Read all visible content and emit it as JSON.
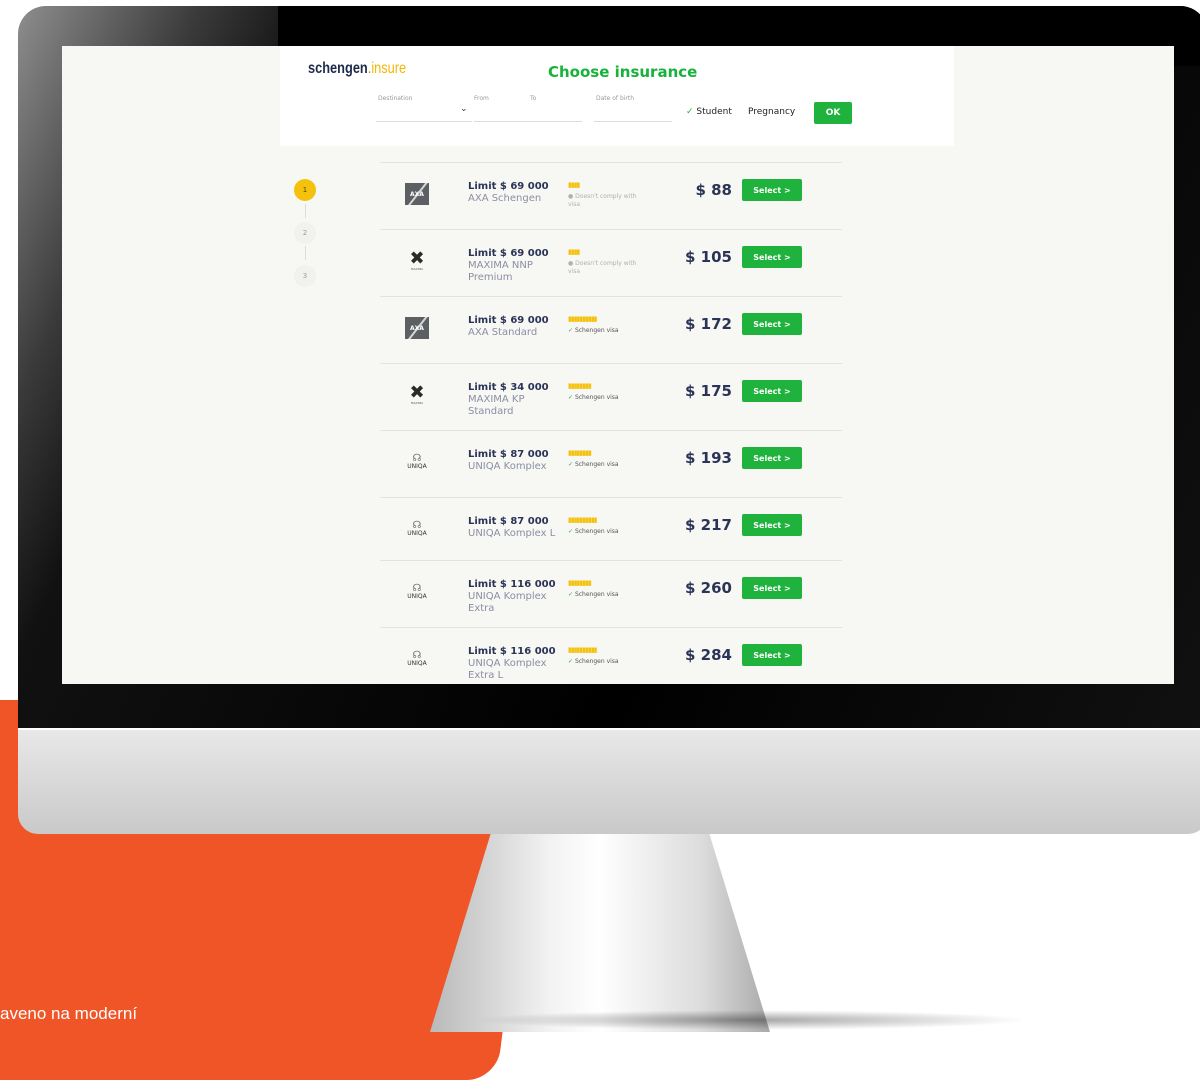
{
  "caption": "aveno na moderní",
  "app": {
    "logo": {
      "part1": "schengen",
      "part2": ".",
      "part3": "insure"
    },
    "title": "Choose insurance",
    "filters": {
      "destination_label": "Destination",
      "from_label": "From",
      "to_label": "To",
      "dob_label": "Date of birth",
      "student_label": "Student",
      "student_checked": true,
      "pregnancy_label": "Pregnancy",
      "pregnancy_checked": false,
      "ok_label": "OK"
    },
    "steps": [
      "1",
      "2",
      "3"
    ],
    "active_step": 1,
    "select_label": "Select >",
    "offers": [
      {
        "provider": "axa",
        "provider_logo": "AXA",
        "limit": "Limit $ 69 000",
        "name": "AXA Schengen",
        "rating": 4,
        "visa_text": "Doesn't comply with visa",
        "visa_ok": false,
        "price": "$ 88"
      },
      {
        "provider": "maxima",
        "provider_logo": "MAXIMA",
        "limit": "Limit $ 69 000",
        "name": "MAXIMA NNP Premium",
        "rating": 4,
        "visa_text": "Doesn't comply with visa",
        "visa_ok": false,
        "price": "$ 105"
      },
      {
        "provider": "axa",
        "provider_logo": "AXA",
        "limit": "Limit $ 69 000",
        "name": "AXA Standard",
        "rating": 10,
        "visa_text": "Schengen visa",
        "visa_ok": true,
        "price": "$ 172"
      },
      {
        "provider": "maxima",
        "provider_logo": "MAXIMA",
        "limit": "Limit $ 34 000",
        "name": "MAXIMA KP Standard",
        "rating": 8,
        "visa_text": "Schengen visa",
        "visa_ok": true,
        "price": "$ 175"
      },
      {
        "provider": "uniqa",
        "provider_logo": "UNIQA",
        "limit": "Limit $ 87 000",
        "name": "UNIQA Komplex",
        "rating": 8,
        "visa_text": "Schengen visa",
        "visa_ok": true,
        "price": "$ 193"
      },
      {
        "provider": "uniqa",
        "provider_logo": "UNIQA",
        "limit": "Limit $ 87 000",
        "name": "UNIQA Komplex L",
        "rating": 10,
        "visa_text": "Schengen visa",
        "visa_ok": true,
        "price": "$ 217"
      },
      {
        "provider": "uniqa",
        "provider_logo": "UNIQA",
        "limit": "Limit $ 116 000",
        "name": "UNIQA Komplex Extra",
        "rating": 8,
        "visa_text": "Schengen visa",
        "visa_ok": true,
        "price": "$ 260"
      },
      {
        "provider": "uniqa",
        "provider_logo": "UNIQA",
        "limit": "Limit $ 116 000",
        "name": "UNIQA Komplex Extra L",
        "rating": 10,
        "visa_text": "Schengen visa",
        "visa_ok": true,
        "price": "$ 284"
      }
    ]
  }
}
